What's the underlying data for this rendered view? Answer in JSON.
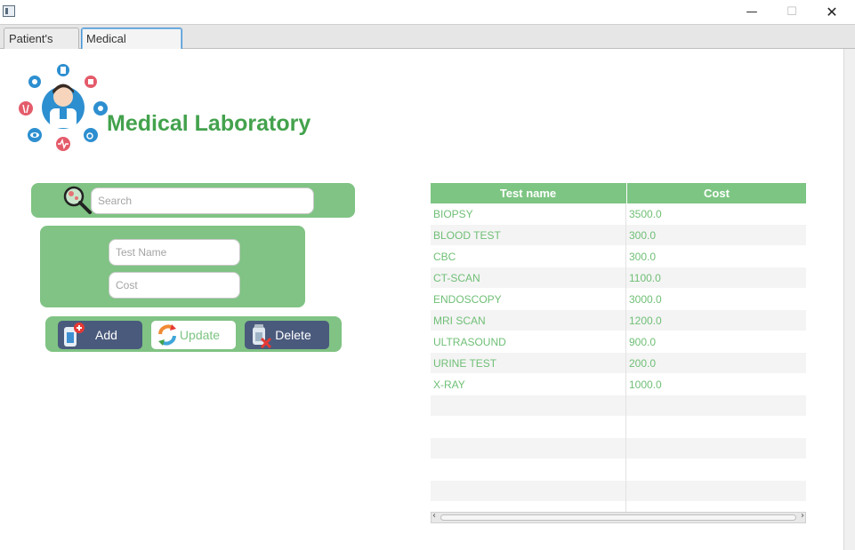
{
  "window": {
    "minimize_glyph": "—",
    "maximize_glyph": "☐",
    "close_glyph": "✕"
  },
  "tabs": [
    {
      "label": "Patient's Tests",
      "selected": false
    },
    {
      "label": "Medical Laboratory",
      "selected": true
    }
  ],
  "header": {
    "title": "Medical Laboratory"
  },
  "search": {
    "placeholder": "Search"
  },
  "form": {
    "test_name_placeholder": "Test Name",
    "cost_placeholder": "Cost"
  },
  "buttons": {
    "add_label": "Add",
    "update_label": "Update",
    "delete_label": "Delete"
  },
  "table": {
    "columns": [
      "Test name",
      "Cost"
    ],
    "rows": [
      {
        "name": "BIOPSY",
        "cost": "3500.0"
      },
      {
        "name": "BLOOD TEST",
        "cost": "300.0"
      },
      {
        "name": "CBC",
        "cost": "300.0"
      },
      {
        "name": "CT-SCAN",
        "cost": "1100.0"
      },
      {
        "name": "ENDOSCOPY",
        "cost": "3000.0"
      },
      {
        "name": "MRI SCAN",
        "cost": "1200.0"
      },
      {
        "name": "ULTRASOUND",
        "cost": "900.0"
      },
      {
        "name": "URINE TEST",
        "cost": "200.0"
      },
      {
        "name": "X-RAY",
        "cost": "1000.0"
      }
    ],
    "empty_rows": 6
  },
  "colors": {
    "accent_green": "#80c384",
    "title_green": "#43a24d",
    "button_dark": "#4a5a7c",
    "tab_focus": "#4c95d4"
  },
  "icons": {
    "app": "app-window-icon",
    "logo": "doctor-medical-logo",
    "search": "magnifier-icon",
    "add": "add-test-icon",
    "update": "refresh-icon",
    "delete": "delete-test-icon"
  }
}
